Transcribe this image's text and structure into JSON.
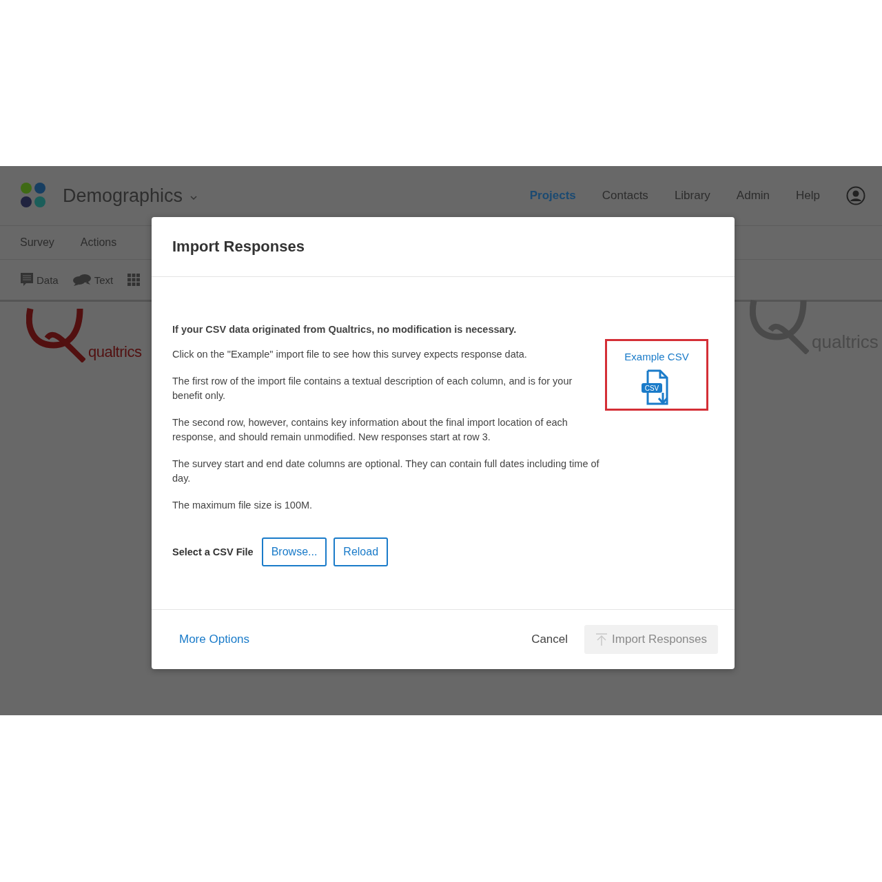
{
  "app": {
    "title": "Demographics",
    "nav": [
      {
        "label": "Projects",
        "selected": true
      },
      {
        "label": "Contacts",
        "selected": false
      },
      {
        "label": "Library",
        "selected": false
      },
      {
        "label": "Admin",
        "selected": false
      },
      {
        "label": "Help",
        "selected": false
      }
    ],
    "tabs": [
      {
        "label": "Survey"
      },
      {
        "label": "Actions"
      }
    ],
    "toolbar": [
      {
        "kind": "comment",
        "label": "Data"
      },
      {
        "kind": "chat",
        "label": "Text"
      },
      {
        "kind": "grid"
      }
    ],
    "logos": [
      "qualtrics",
      "qualtrics"
    ]
  },
  "dialog": {
    "title": "Import Responses",
    "lead": "If your CSV data originated from Qualtrics, no modification is necessary.",
    "paragraphs": [
      "Click on the \"Example\" import file to see how this survey expects response data.",
      "The first row of the import file contains a textual description of each column, and is for your benefit only.",
      "The second row, however, contains key information about the final import location of each response, and should remain unmodified. New responses start at row 3.",
      "The survey start and end date columns are optional. They can contain full dates including time of day.",
      "The maximum file size is 100M."
    ],
    "example": {
      "label": "Example CSV",
      "icon_text": "CSV",
      "highlighted": true
    },
    "file_label": "Select a CSV File",
    "file_buttons": [
      "Browse...",
      "Reload"
    ],
    "more_options": "More Options",
    "cancel": "Cancel",
    "submit": {
      "label": "Import Responses",
      "disabled": true
    }
  }
}
